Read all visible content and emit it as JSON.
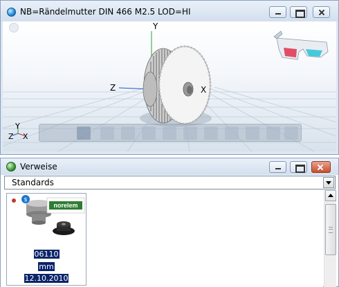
{
  "preview_window": {
    "title": "NB=Rändelmutter DIN 466 M2.5 LOD=HI",
    "buttons": {
      "minimize": "minimize",
      "maximize": "maximize",
      "close": "close"
    },
    "axes": {
      "y": "Y",
      "x": "X",
      "z": "Z"
    },
    "triad": {
      "y": "Y",
      "z": "Z",
      "x": "X"
    },
    "icons": [
      "nav-circle-icon",
      "3d-glasses-icon",
      "cube-view-icon"
    ]
  },
  "references_window": {
    "title": "Verweise",
    "filter_select": {
      "value": "Standards"
    },
    "item": {
      "brand": "norelem",
      "number": "06110",
      "unit": "mm",
      "date": "12.10.2010"
    }
  },
  "colors": {
    "accent_brand_green": "#2e7d32",
    "selection_blue": "#0a246a",
    "close_red": "#c84f2d"
  }
}
